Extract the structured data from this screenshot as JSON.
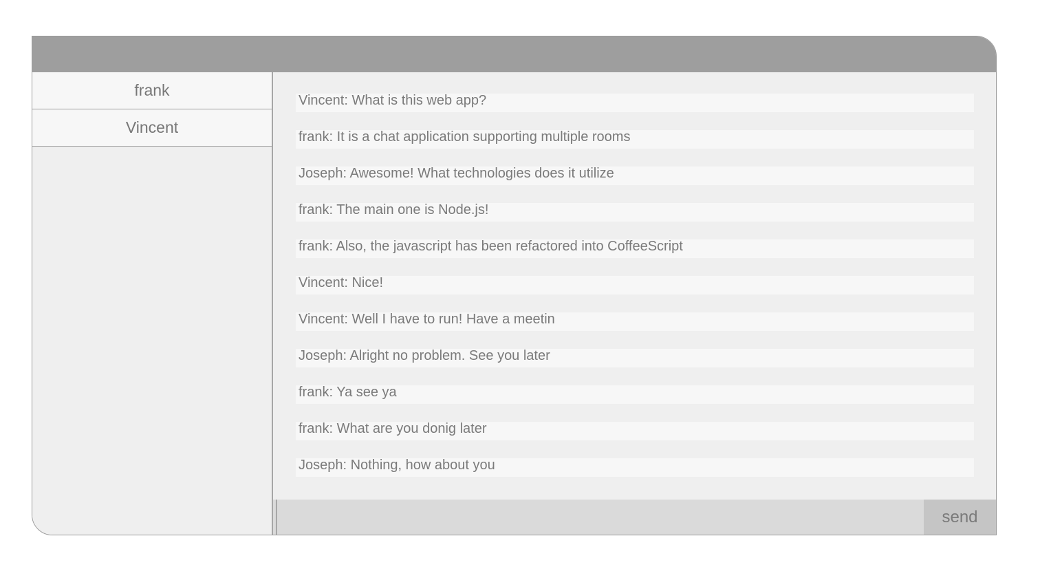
{
  "sidebar": {
    "users": [
      {
        "name": "frank"
      },
      {
        "name": "Vincent"
      }
    ]
  },
  "chat": {
    "messages": [
      {
        "text": "Vincent: What is this web app?"
      },
      {
        "text": "frank: It is a chat application supporting multiple rooms"
      },
      {
        "text": "Joseph: Awesome! What technologies does it utilize"
      },
      {
        "text": "frank: The main one is Node.js!"
      },
      {
        "text": "frank: Also, the javascript has been refactored into CoffeeScript"
      },
      {
        "text": "Vincent: Nice!"
      },
      {
        "text": "Vincent: Well I have to run! Have a meetin"
      },
      {
        "text": "Joseph: Alright no problem. See you later"
      },
      {
        "text": "frank: Ya see ya"
      },
      {
        "text": "frank: What are you donig later"
      },
      {
        "text": "Joseph: Nothing, how about you"
      }
    ]
  },
  "compose": {
    "value": "",
    "send_label": "send"
  }
}
